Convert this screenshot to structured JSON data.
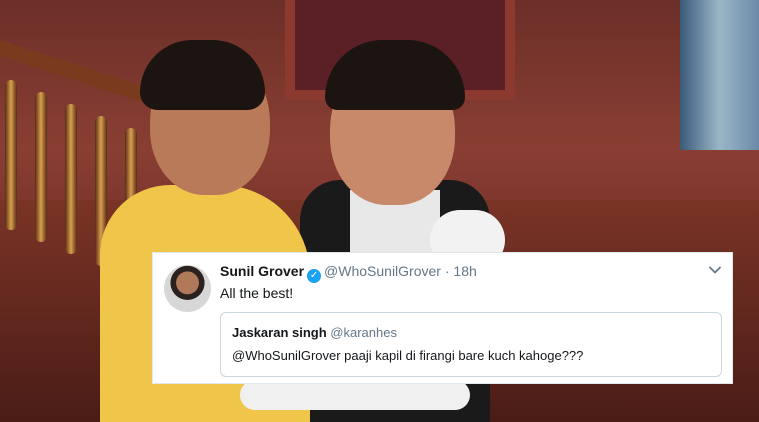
{
  "tweet": {
    "author_name": "Sunil Grover",
    "verified_icon": "verified-badge-icon",
    "author_handle": "@WhoSunilGrover",
    "separator": "·",
    "time": "18h",
    "text": "All the best!",
    "quoted": {
      "author_name": "Jaskaran singh",
      "author_handle": "@karanhes",
      "text": "@WhoSunilGrover paaji kapil di firangi bare kuch kahoge???"
    }
  },
  "colors": {
    "verified": "#1da1f2",
    "secondary_text": "#657786",
    "primary_text": "#14171a"
  }
}
